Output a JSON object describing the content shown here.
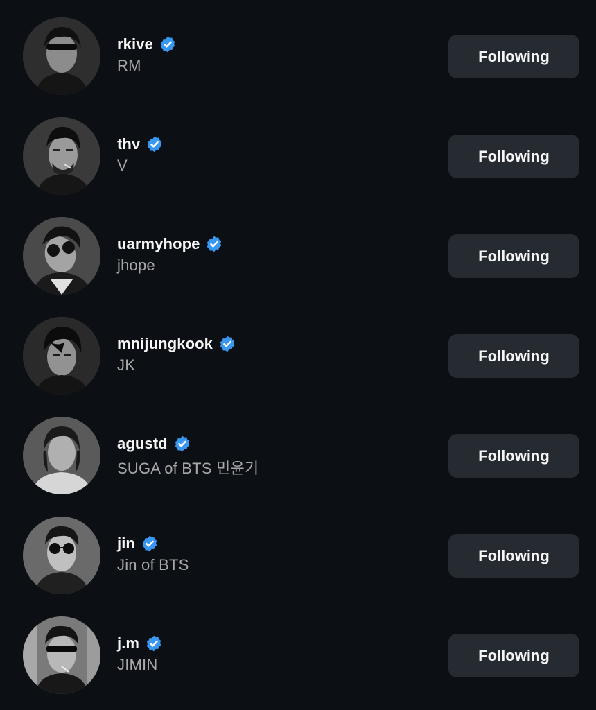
{
  "accounts": [
    {
      "username": "rkive",
      "full_name": "RM",
      "verified": true,
      "button_label": "Following"
    },
    {
      "username": "thv",
      "full_name": "V",
      "verified": true,
      "button_label": "Following"
    },
    {
      "username": "uarmyhope",
      "full_name": "jhope",
      "verified": true,
      "button_label": "Following"
    },
    {
      "username": "mnijungkook",
      "full_name": "JK",
      "verified": true,
      "button_label": "Following"
    },
    {
      "username": "agustd",
      "full_name": "SUGA of BTS 민윤기",
      "verified": true,
      "button_label": "Following"
    },
    {
      "username": "jin",
      "full_name": "Jin of BTS",
      "verified": true,
      "button_label": "Following"
    },
    {
      "username": "j.m",
      "full_name": "JIMIN",
      "verified": true,
      "button_label": "Following"
    }
  ],
  "colors": {
    "background": "#0c1014",
    "button_bg": "#262a31",
    "verified_badge": "#3897f0",
    "primary_text": "#f5f5f5",
    "secondary_text": "#a8a8a8"
  },
  "icons": {
    "verified": "verified-badge-icon",
    "avatar": "profile-photo"
  }
}
